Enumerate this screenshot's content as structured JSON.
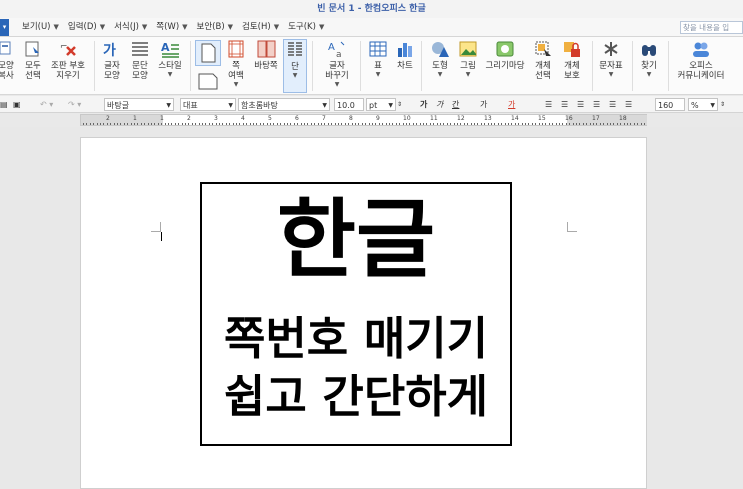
{
  "window": {
    "title": "빈 문서 1 - 한컴오피스 한글"
  },
  "menu": {
    "items": [
      {
        "label": "보기(U)"
      },
      {
        "label": "입력(D)"
      },
      {
        "label": "서식(J)"
      },
      {
        "label": "쪽(W)"
      },
      {
        "label": "보안(B)"
      },
      {
        "label": "검토(H)"
      },
      {
        "label": "도구(K)"
      }
    ],
    "search_placeholder": "찾을 내용을 입"
  },
  "ribbon": {
    "shape_copy": "모양\n복사",
    "select_all": "모두\n선택",
    "remove_format": "조판 부호\n지우기",
    "char_shape": "글자\n모양",
    "para_shape": "문단\n모양",
    "style": "스타일",
    "page_margin": "쪽\n여백",
    "bg": "바탕쪽",
    "column": "단",
    "char_change": "글자\n바꾸기",
    "table": "표",
    "chart": "차트",
    "shape": "도형",
    "picture": "그림",
    "gallery": "그리기마당",
    "obj_select": "개체\n선택",
    "obj_protect": "개체\n보호",
    "charmap": "문자표",
    "find": "찾기",
    "office_comm": "오피스\n커뮤니케이터"
  },
  "format_bar": {
    "style_name": "바탕글",
    "lang": "대표",
    "font": "함초롬바탕",
    "size": "10.0",
    "unit": "pt",
    "zoom": "160",
    "zoom_unit": "%"
  },
  "ruler": {
    "numbers": [
      "2",
      "1",
      "1",
      "2",
      "3",
      "4",
      "5",
      "6",
      "7",
      "8",
      "9",
      "10",
      "11",
      "12",
      "13",
      "14",
      "15",
      "16",
      "17",
      "18"
    ]
  },
  "document": {
    "line1": "한글",
    "line2": "쪽번호 매기기",
    "line3": "쉽고 간단하게"
  }
}
